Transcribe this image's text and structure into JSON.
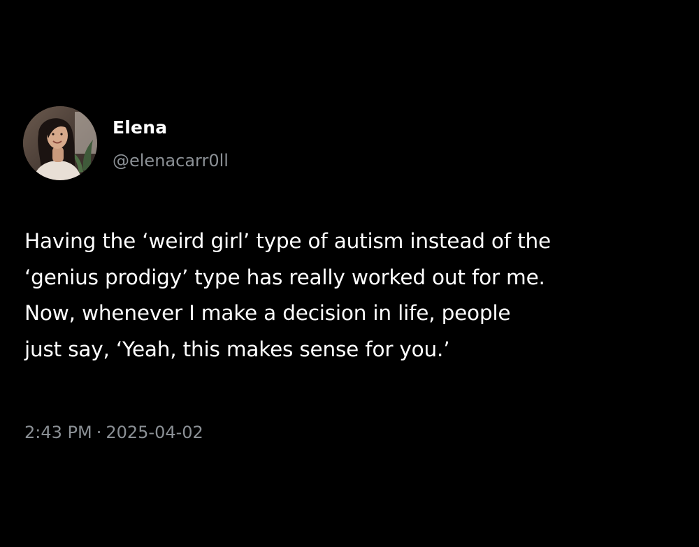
{
  "author": {
    "display_name": "Elena",
    "handle": "@elenacarr0ll",
    "avatar_icon": "profile-photo"
  },
  "tweet": {
    "text_lines": [
      "Having the ‘weird girl’ type of autism instead of the",
      "‘genius prodigy’ type has really worked out for me.",
      "Now, whenever I make a decision in life, people",
      "just say, ‘Yeah, this makes sense for you.’"
    ],
    "time": "2:43 PM",
    "separator": "·",
    "date": "2025-04-02"
  },
  "colors": {
    "background": "#000000",
    "primary_text": "#ffffff",
    "secondary_text": "#8b9095"
  }
}
